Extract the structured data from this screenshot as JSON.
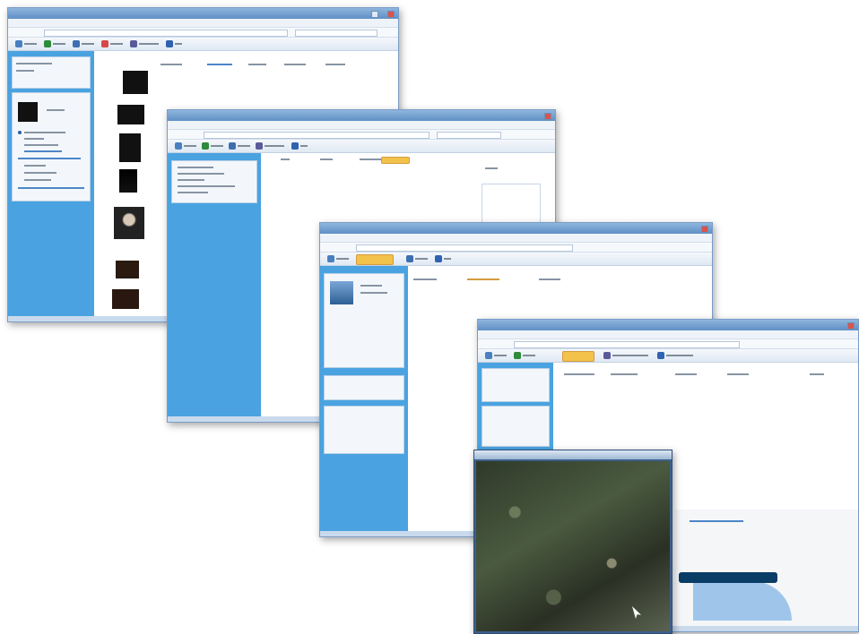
{
  "window_titles": [
    "",
    "",
    "",
    ""
  ],
  "photo_window_title": "",
  "map_link_text": ""
}
